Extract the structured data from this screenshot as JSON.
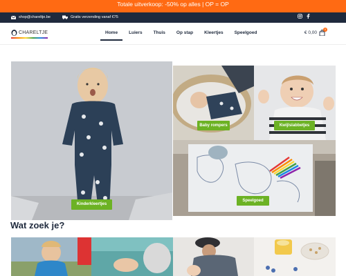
{
  "promo": {
    "text": "Totale uitverkoop: -50% op alles | OP = OP",
    "bg": "#ff6a13"
  },
  "info": {
    "email": "shop@chareltje.be",
    "shipping": "Gratis verzending vanaf €75",
    "bg": "#1f2a3d",
    "icons": [
      "mail-icon",
      "truck-icon",
      "instagram-icon",
      "facebook-icon"
    ]
  },
  "logo": {
    "text": "CHARELTJE"
  },
  "nav": {
    "items": [
      "Home",
      "Luiers",
      "Thuis",
      "Op stap",
      "Kleertjes",
      "Speelgoed"
    ],
    "active": "Home"
  },
  "cart": {
    "total": "€ 0,00",
    "count": "0"
  },
  "tiles": {
    "kinderkleertjes": "Kinderkleertjes",
    "baby_rompers": "Baby rompers",
    "kwijlslabbetjes": "Kwijlslabbetjes",
    "speelgoed": "Speelgoed"
  },
  "section": {
    "title": "Wat zoek je?"
  },
  "accent": "#6cb224"
}
